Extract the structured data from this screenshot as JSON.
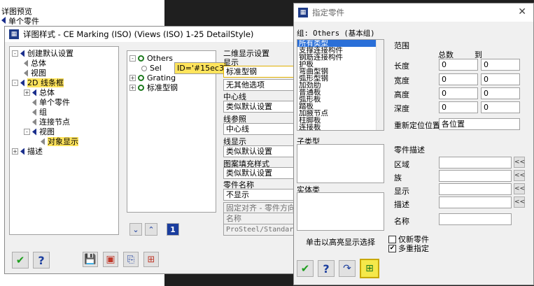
{
  "bg_window": {
    "item1": "详图预览",
    "item2": "单个零件"
  },
  "left_dialog": {
    "title": "详图样式 - CE Marking (ISO) (Views (ISO) 1-25 DetailStyle)",
    "tree": [
      "创建默认设置",
      "总体",
      "视图",
      "2D 线条框",
      "总体",
      "单个零件",
      "组",
      "连接节点",
      "视图",
      "对象显示",
      "描述"
    ],
    "mid_tree": [
      "Others",
      "Sel",
      "Grating",
      "标准型钢"
    ],
    "tooltip": "ID='#15ec3",
    "right_section": {
      "heading": "二维显示设置",
      "display_label": "显示",
      "display_value": "标准型钢",
      "other_options": "无其他选项",
      "center_label": "中心线",
      "center_value": "类似默认设置",
      "ref_label": "线参照",
      "ref_value": "中心线",
      "line_label": "线显示",
      "line_value": "类似默认设置",
      "hatch_label": "图案填充样式",
      "hatch_value": "类似默认设置",
      "partname_label": "零件名称",
      "partname_value": "不显示",
      "align_value": "固定对齐 - 零件方向",
      "name_header": "名称",
      "name_value": "ProSteel/Standard"
    },
    "num_button": "1",
    "bottom": {
      "ok": "✔",
      "help": "?"
    }
  },
  "right_dialog": {
    "title": "指定零件",
    "group_label": "组: Others (基本组)",
    "list_items": [
      "所有类型",
      "支撑连接构件",
      "钢筋连接构件",
      "护板",
      "弯曲型钢",
      "弧形型钢",
      "加劲肋",
      "普通板",
      "弧形板",
      "踏板",
      "加腋节点",
      "柱脚板",
      "连接板"
    ],
    "range": {
      "heading": "范围",
      "total": "总数",
      "to": "到",
      "rows": [
        {
          "label": "长度",
          "v1": "0",
          "v2": "0"
        },
        {
          "label": "宽度",
          "v1": "0",
          "v2": "0"
        },
        {
          "label": "高度",
          "v1": "0",
          "v2": "0"
        },
        {
          "label": "深度",
          "v1": "0",
          "v2": "0"
        }
      ]
    },
    "reposition_label": "重新定位位置",
    "reposition_value": "各位置",
    "subtype_label": "子类型",
    "solid_label": "实体类",
    "desc": {
      "heading": "零件描述",
      "rows": [
        "区域",
        "族",
        "显示",
        "描述"
      ],
      "name_label": "名称"
    },
    "highlight_button": "单击以高亮显示选择",
    "only_new": "仅新零件",
    "multi": "多重指定",
    "bottom": {
      "ok": "✔",
      "help": "?"
    }
  }
}
